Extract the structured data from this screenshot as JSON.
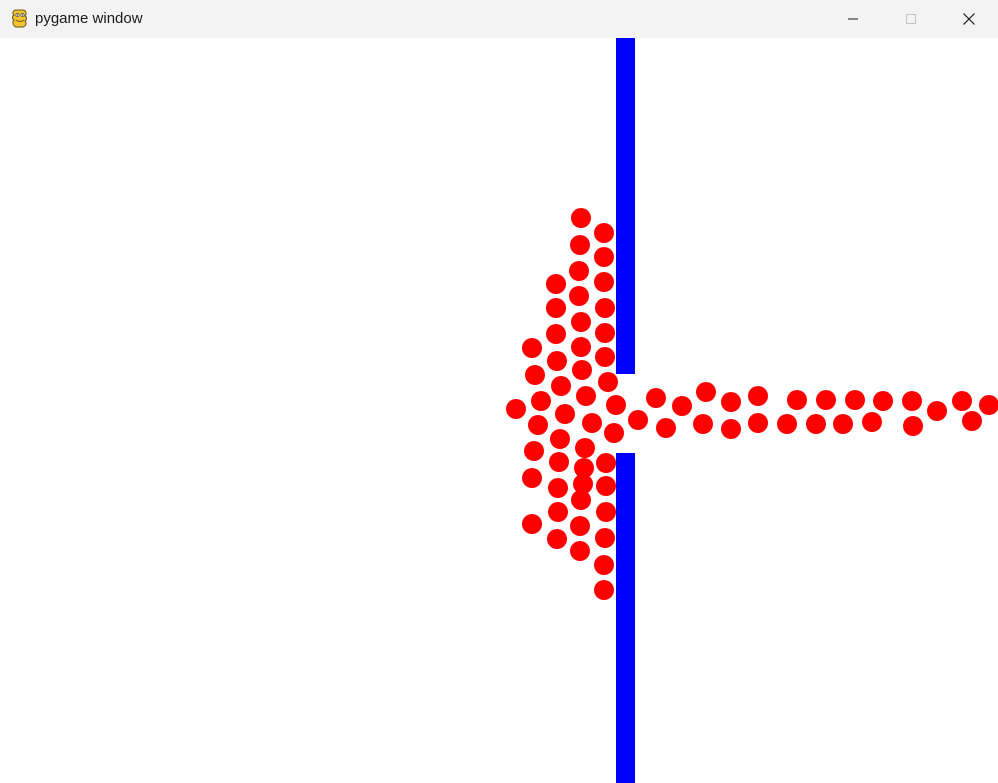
{
  "window": {
    "title": "pygame window"
  },
  "controls": {
    "minimize_icon": "minimize-icon",
    "maximize_icon": "maximize-icon",
    "close_icon": "close-icon"
  },
  "scene": {
    "background_color": "#ffffff",
    "wall_color": "#0000ff",
    "particle_color": "#ff0000",
    "particle_count": 93
  }
}
